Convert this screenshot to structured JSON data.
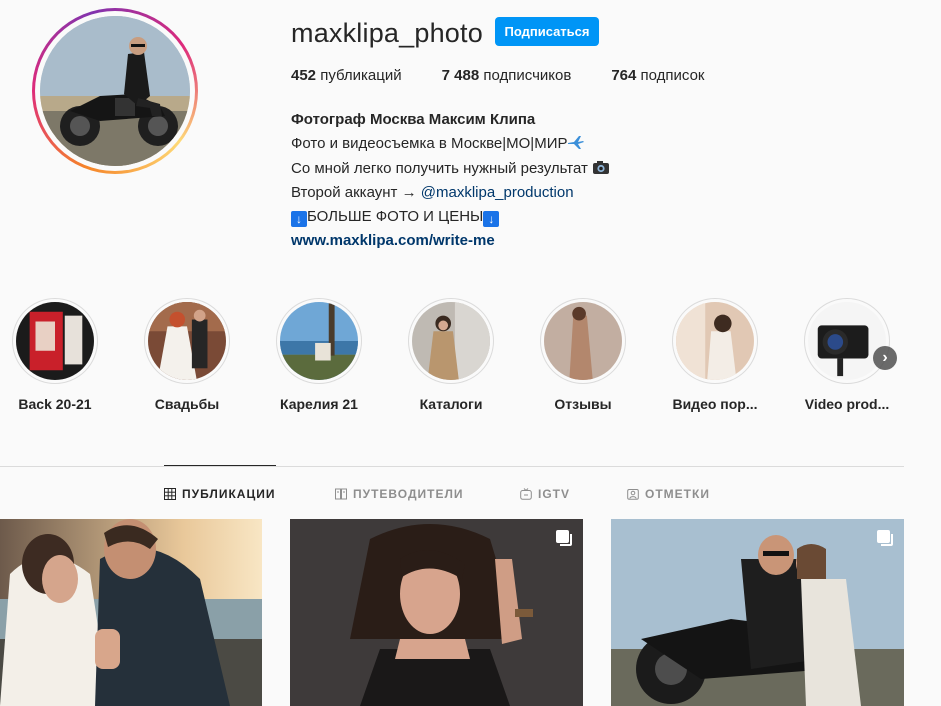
{
  "profile": {
    "username": "maxklipa_photo",
    "follow_label": "Подписаться",
    "stats": {
      "posts_count": "452",
      "posts_label": "публикаций",
      "followers_count": "7 488",
      "followers_label": "подписчиков",
      "following_count": "764",
      "following_label": "подписок"
    },
    "bio": {
      "name": "Фотограф Москва Максим Клипа",
      "line1": "Фото и видеосъемка в Москве|МО|МИР",
      "line2": "Со мной легко получить нужный результат",
      "line3_prefix": "Второй аккаунт → ",
      "line3_mention": "@maxklipa_production",
      "line4_arrow": "↓",
      "line4_text": "БОЛЬШЕ ФОТО И ЦЕНЫ",
      "website": "www.maxklipa.com/write-me"
    }
  },
  "highlights": [
    {
      "label": "Back 20-21"
    },
    {
      "label": "Свадьбы"
    },
    {
      "label": "Карелия 21"
    },
    {
      "label": "Каталоги"
    },
    {
      "label": "Отзывы"
    },
    {
      "label": "Видео пор..."
    },
    {
      "label": "Video prod..."
    }
  ],
  "tabs": [
    {
      "label": "ПУБЛИКАЦИИ",
      "active": true
    },
    {
      "label": "ПУТЕВОДИТЕЛИ",
      "active": false
    },
    {
      "label": "IGTV",
      "active": false
    },
    {
      "label": "ОТМЕТКИ",
      "active": false
    }
  ],
  "colors": {
    "accent": "#0095f6",
    "link": "#00376b",
    "text": "#262626",
    "muted": "#8e8e8e",
    "background": "#fafafa"
  },
  "icons": {
    "grid": "grid-icon",
    "guides": "guides-icon",
    "igtv": "igtv-icon",
    "tagged": "tagged-icon",
    "multi": "multiple-photos-icon",
    "next": "chevron-right-icon"
  }
}
